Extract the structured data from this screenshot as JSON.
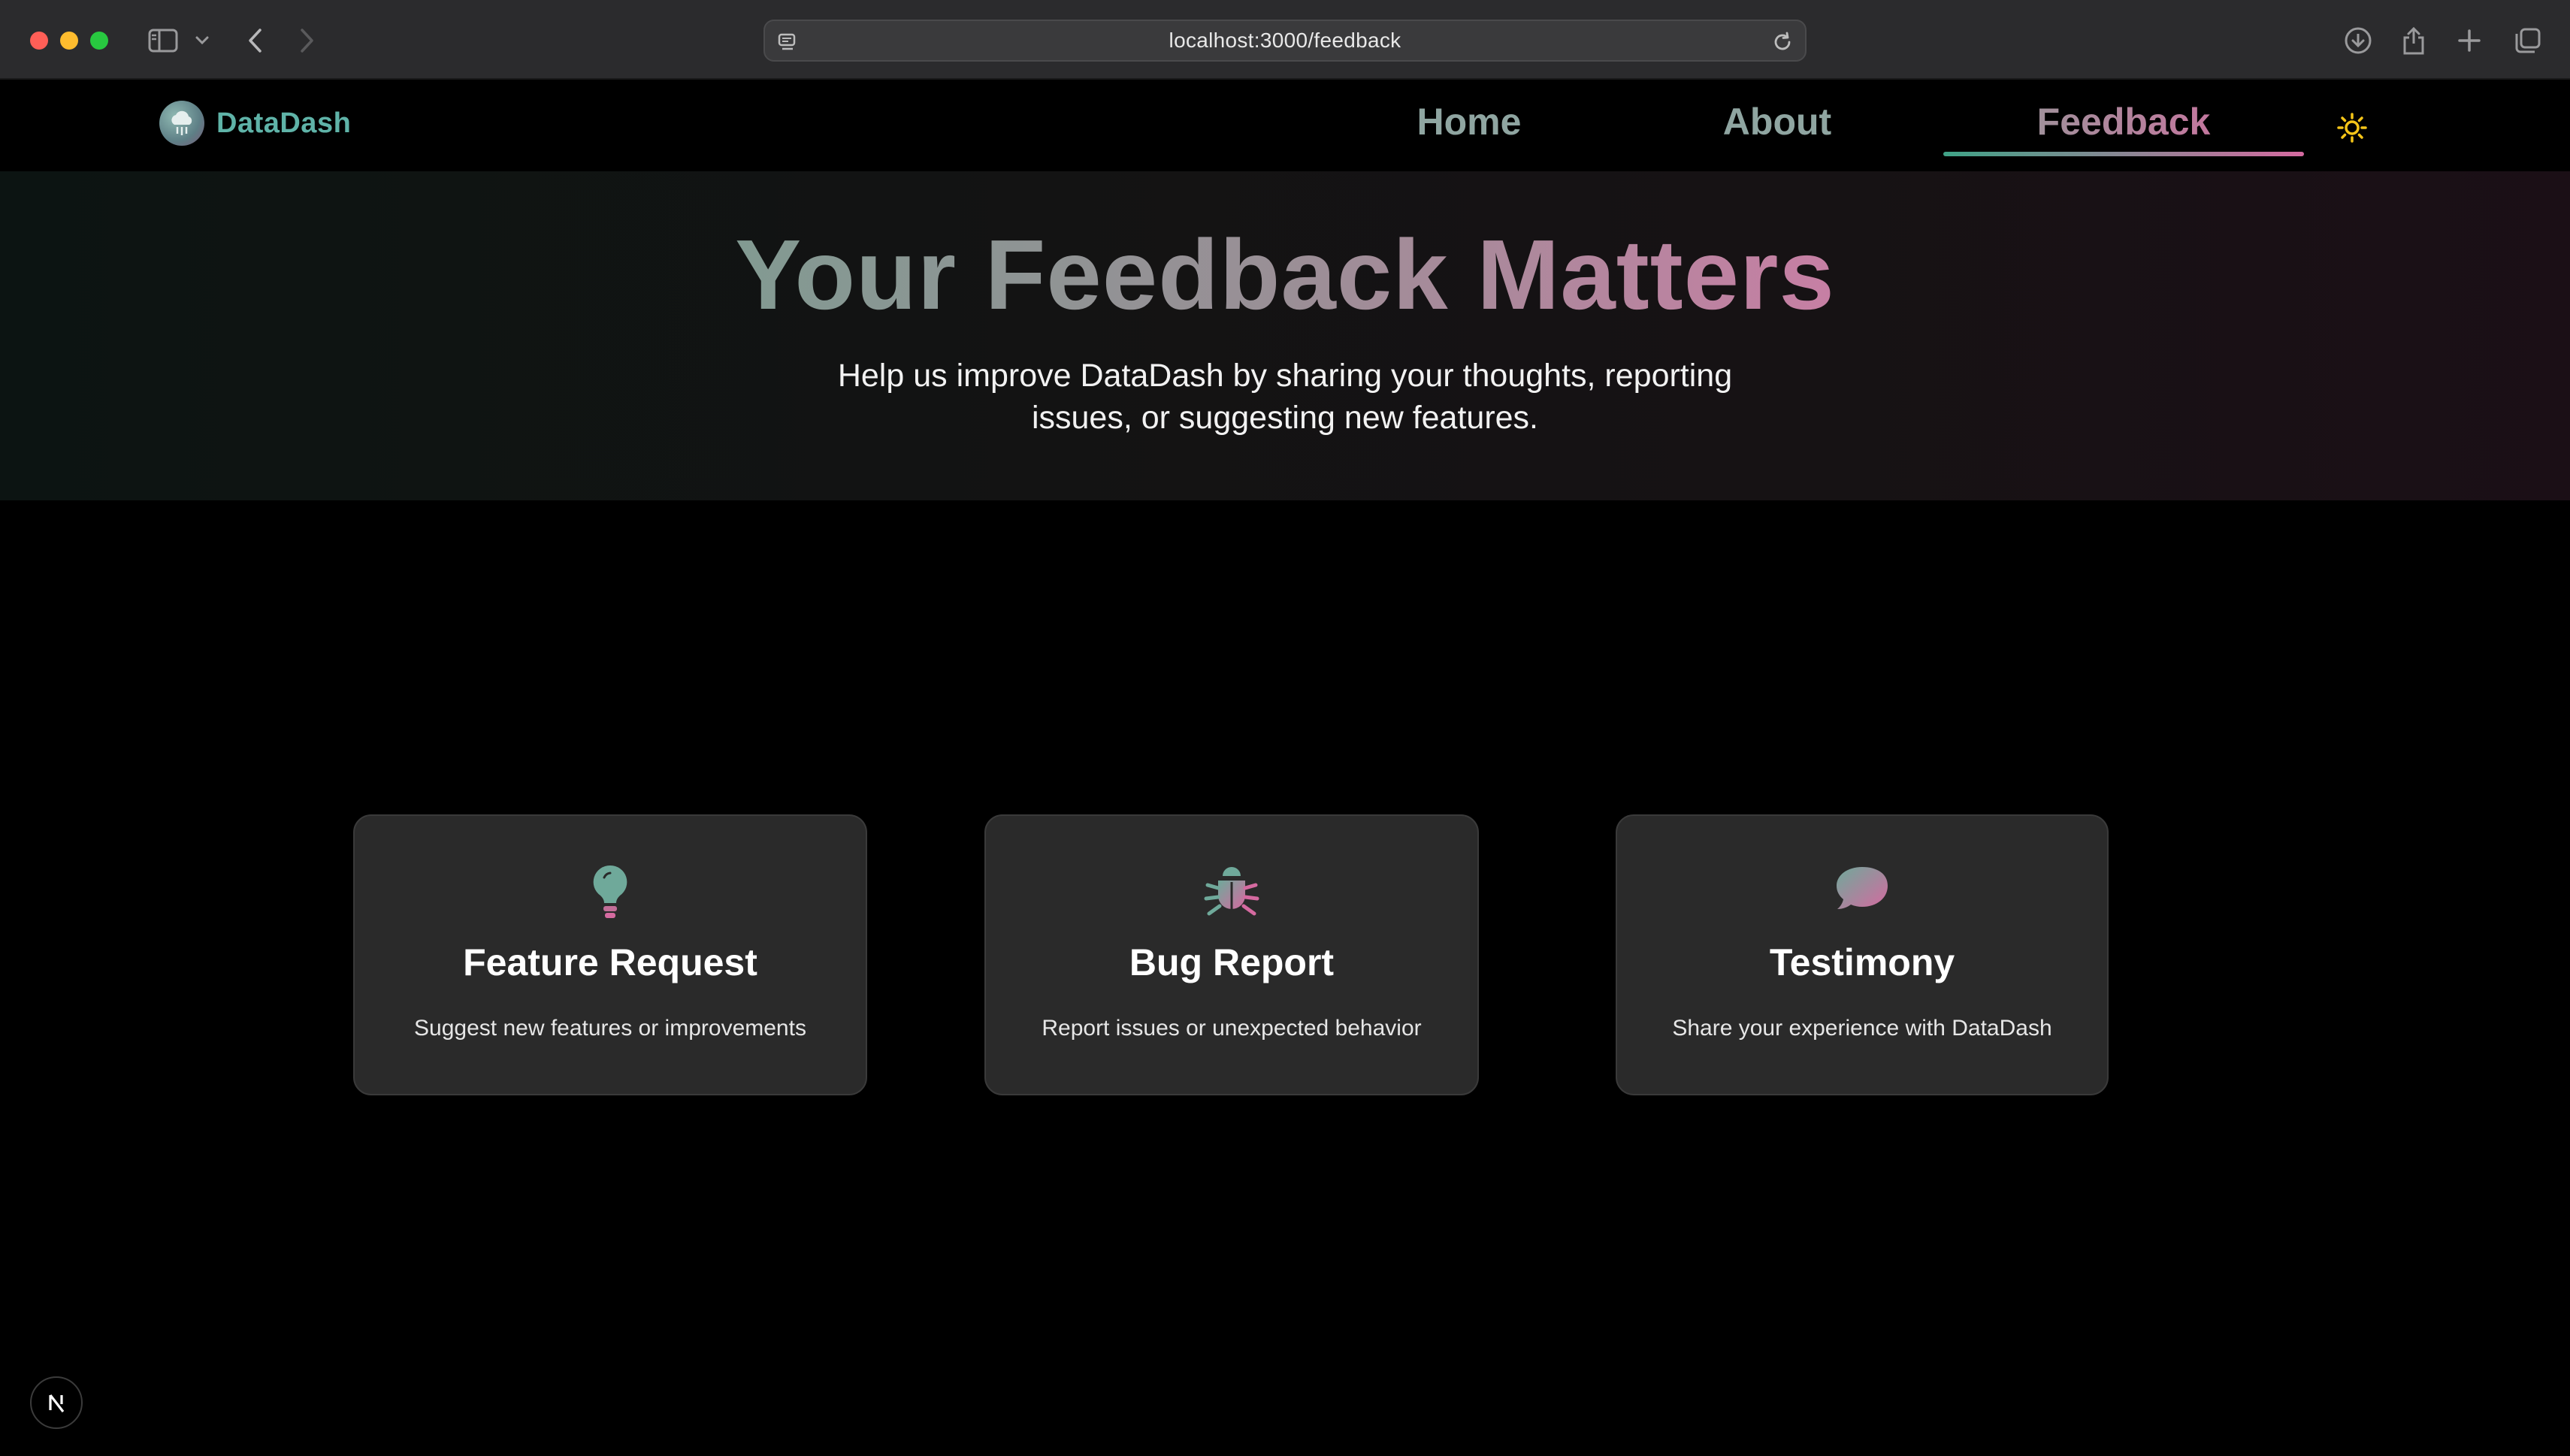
{
  "browser": {
    "url": "localhost:3000/feedback"
  },
  "nav": {
    "logo_text": "DataDash",
    "links": [
      {
        "label": "Home"
      },
      {
        "label": "About"
      },
      {
        "label": "Feedback",
        "active": true
      }
    ],
    "theme_icon": "sun-icon"
  },
  "hero": {
    "title": "Your Feedback Matters",
    "subtitle": "Help us improve DataDash by sharing your thoughts, reporting issues, or suggesting new features."
  },
  "cards": [
    {
      "icon": "lightbulb-icon",
      "title": "Feature Request",
      "description": "Suggest new features or improvements"
    },
    {
      "icon": "bug-icon",
      "title": "Bug Report",
      "description": "Report issues or unexpected behavior"
    },
    {
      "icon": "chat-bubble-icon",
      "title": "Testimony",
      "description": "Share your experience with DataDash"
    }
  ],
  "colors": {
    "accent_teal": "#5fb3a8",
    "accent_pink": "#d56aa0",
    "card_bg": "#2a2a2a",
    "sun": "#f5c518"
  }
}
